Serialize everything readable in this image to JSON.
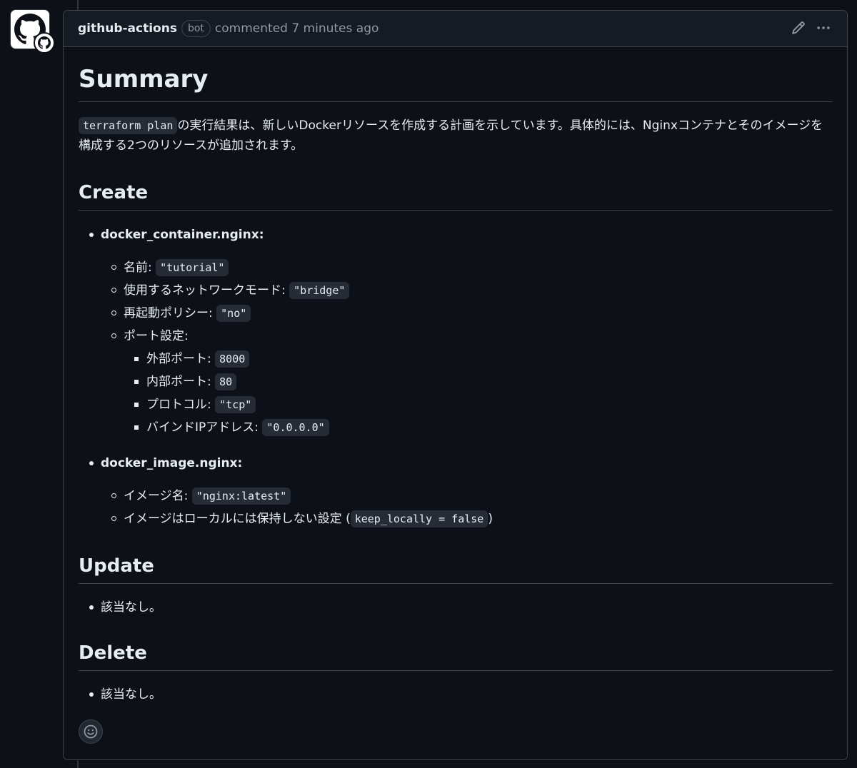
{
  "comment": {
    "author": "github-actions",
    "badge": "bot",
    "meta": "commented 7 minutes ago"
  },
  "summary": {
    "heading": "Summary",
    "code": "terraform plan",
    "text": "の実行結果は、新しいDockerリソースを作成する計画を示しています。具体的には、Nginxコンテナとそのイメージを構成する2つのリソースが追加されます。"
  },
  "create": {
    "heading": "Create",
    "container": {
      "name": "docker_container.nginx:",
      "name_label": "名前: ",
      "name_value": "\"tutorial\"",
      "network_label": "使用するネットワークモード: ",
      "network_value": "\"bridge\"",
      "restart_label": "再起動ポリシー: ",
      "restart_value": "\"no\"",
      "ports_label": "ポート設定:",
      "external_label": "外部ポート: ",
      "external_value": "8000",
      "internal_label": "内部ポート: ",
      "internal_value": "80",
      "protocol_label": "プロトコル: ",
      "protocol_value": "\"tcp\"",
      "ip_label": "バインドIPアドレス: ",
      "ip_value": "\"0.0.0.0\""
    },
    "image": {
      "name": "docker_image.nginx:",
      "image_label": "イメージ名: ",
      "image_value": "\"nginx:latest\"",
      "local_label": "イメージはローカルには保持しない設定 (",
      "local_value": "keep_locally = false",
      "local_suffix": ")"
    }
  },
  "update": {
    "heading": "Update",
    "item": "該当なし。"
  },
  "delete": {
    "heading": "Delete",
    "item": "該当なし。"
  },
  "icons": {
    "avatar": "github-mark-icon",
    "edit": "pencil-icon",
    "more": "kebab-horizontal-icon",
    "reaction": "smiley-icon"
  }
}
